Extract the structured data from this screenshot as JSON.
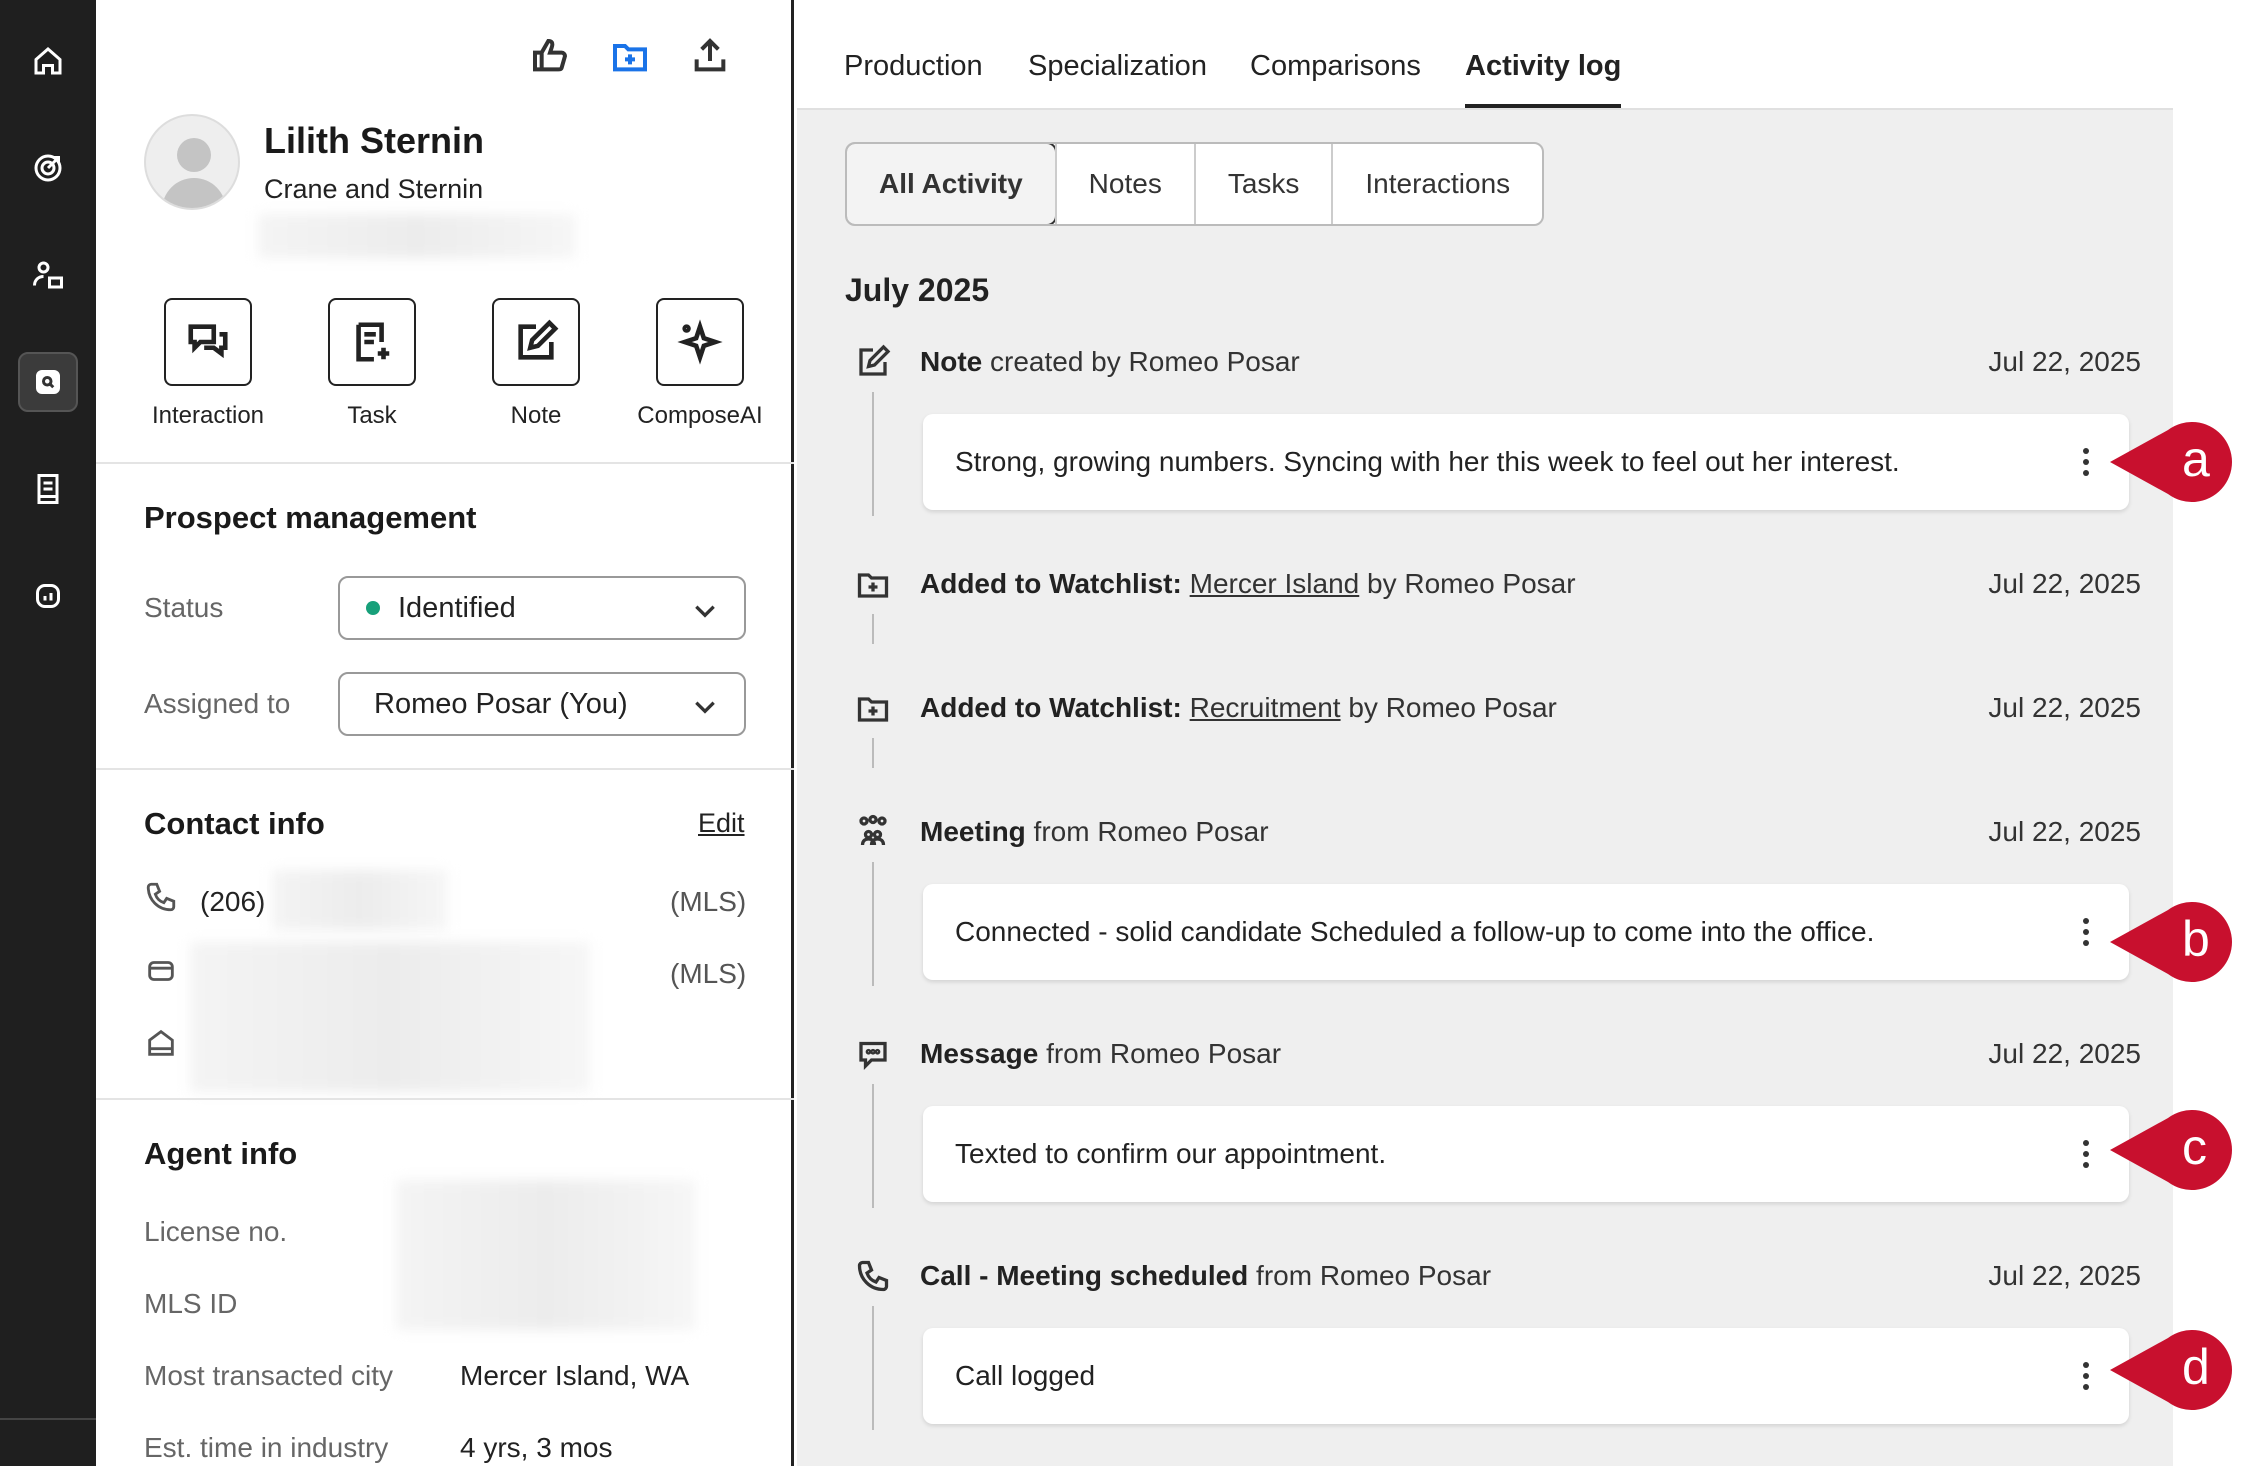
{
  "profile": {
    "name": "Lilith Sternin",
    "company": "Crane and Sternin"
  },
  "actions": [
    {
      "label": "Interaction",
      "icon": "chat-bubbles-icon"
    },
    {
      "label": "Task",
      "icon": "task-add-icon"
    },
    {
      "label": "Note",
      "icon": "note-edit-icon"
    },
    {
      "label": "ComposeAI",
      "icon": "sparkle-icon"
    }
  ],
  "prospect": {
    "heading": "Prospect management",
    "status_label": "Status",
    "status_value": "Identified",
    "status_color": "#17a07a",
    "assigned_label": "Assigned to",
    "assigned_value": "Romeo Posar (You)"
  },
  "contact": {
    "heading": "Contact info",
    "edit_label": "Edit",
    "phone_prefix": "(206)",
    "phone_source": "(MLS)",
    "email_source": "(MLS)"
  },
  "agent": {
    "heading": "Agent info",
    "license_label": "License no.",
    "mls_label": "MLS ID",
    "city_label": "Most transacted city",
    "city_value": "Mercer Island, WA",
    "time_label": "Est. time in industry",
    "time_value": "4 yrs, 3 mos"
  },
  "tabs": [
    "Production",
    "Specialization",
    "Comparisons",
    "Activity log"
  ],
  "filters": [
    "All Activity",
    "Notes",
    "Tasks",
    "Interactions"
  ],
  "month": "July 2025",
  "activities": [
    {
      "bold": "Note",
      "prefix": "",
      "link": "",
      "rest": " created by Romeo Posar",
      "date": "Jul 22, 2025",
      "card": "Strong, growing numbers. Syncing with her this week to feel out her interest.",
      "callout": "a"
    },
    {
      "bold": "Added to Watchlist:",
      "prefix": " ",
      "link": "Mercer Island",
      "rest": " by Romeo Posar",
      "date": "Jul 22, 2025",
      "card": "",
      "callout": ""
    },
    {
      "bold": "Added to Watchlist:",
      "prefix": " ",
      "link": "Recruitment",
      "rest": " by Romeo Posar",
      "date": "Jul 22, 2025",
      "card": "",
      "callout": ""
    },
    {
      "bold": "Meeting",
      "prefix": "",
      "link": "",
      "rest": " from Romeo Posar",
      "date": "Jul 22, 2025",
      "card": "Connected - solid candidate Scheduled a follow-up to come into the office.",
      "callout": "b"
    },
    {
      "bold": "Message",
      "prefix": "",
      "link": "",
      "rest": " from Romeo Posar",
      "date": "Jul 22, 2025",
      "card": "Texted to confirm our appointment.",
      "callout": "c"
    },
    {
      "bold": "Call - Meeting scheduled",
      "prefix": "",
      "link": "",
      "rest": " from Romeo Posar",
      "date": "Jul 22, 2025",
      "card": "Call logged",
      "callout": "d"
    }
  ],
  "callout_color": "#c8102e"
}
